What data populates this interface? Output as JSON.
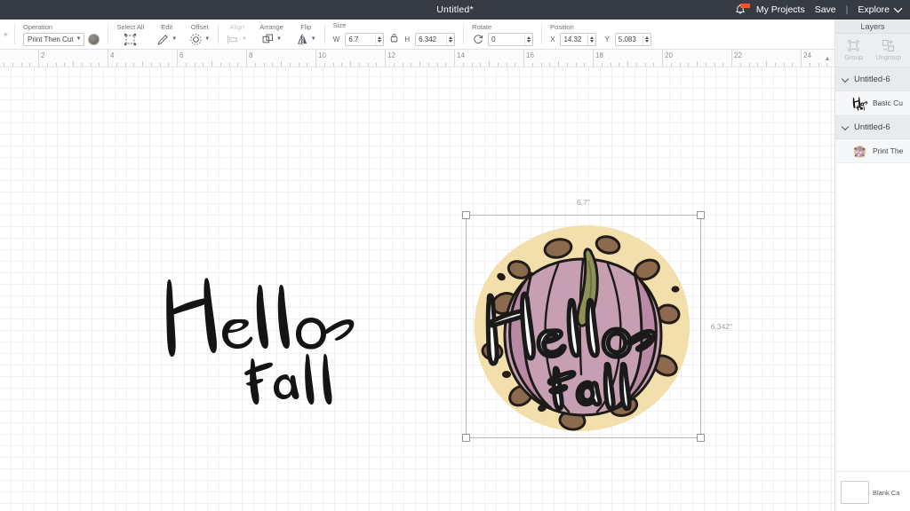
{
  "topbar": {
    "title": "Untitled*",
    "bell_icon": "bell-icon",
    "my_projects": "My Projects",
    "save": "Save",
    "divider": "|",
    "machine": "Explore",
    "machine_caret": "chevron-down-icon"
  },
  "toolbar": {
    "operation": {
      "label": "Operation",
      "value": "Print Then Cut",
      "color_swatch": "color-swatch"
    },
    "select_all": {
      "label": "Select All",
      "icon": "select-all-icon"
    },
    "edit": {
      "label": "Edit",
      "icon": "pencil-icon"
    },
    "offset": {
      "label": "Offset",
      "icon": "offset-icon"
    },
    "align": {
      "label": "Align",
      "icon": "align-icon",
      "disabled": true
    },
    "arrange": {
      "label": "Arrange",
      "icon": "arrange-icon"
    },
    "flip": {
      "label": "Flip",
      "icon": "flip-icon"
    },
    "size": {
      "label": "Size",
      "lock_icon": "lock-icon",
      "w_letter": "W",
      "w_value": "6.7",
      "h_letter": "H",
      "h_value": "6.342"
    },
    "rotate": {
      "label": "Rotate",
      "icon": "rotate-icon",
      "value": "0"
    },
    "position": {
      "label": "Position",
      "x_letter": "X",
      "x_value": "14.32",
      "y_letter": "Y",
      "y_value": "5.083"
    }
  },
  "ruler": {
    "labels": [
      "2",
      "4",
      "6",
      "8",
      "10",
      "12",
      "14",
      "16",
      "18",
      "20",
      "22",
      "24"
    ],
    "scroll_up_icon": "caret-up-icon"
  },
  "canvas": {
    "selection": {
      "width_label": "6.7\"",
      "height_label": "6.342\"",
      "handles": [
        "top-left",
        "top-right",
        "bottom-left",
        "bottom-right"
      ]
    },
    "artwork_black": {
      "line1": "Hello",
      "line2": "Fall"
    },
    "artwork_pumpkin": {
      "line1": "Hello",
      "line2": "Fall"
    }
  },
  "right_panel": {
    "tab": "Layers",
    "group_button": {
      "label": "Group",
      "icon": "group-icon"
    },
    "ungroup_button": {
      "label": "Ungroup",
      "icon": "ungroup-icon"
    },
    "layers": [
      {
        "group_name": "Untitled-6",
        "child_label": "Basic Cu",
        "thumb": "hello-fall-black-thumb"
      },
      {
        "group_name": "Untitled-6",
        "child_label": "Print The",
        "thumb": "pumpkin-thumb"
      }
    ],
    "canvas_chip": {
      "label": "Blank Ca",
      "swatch": "blank-canvas-swatch"
    }
  },
  "colors": {
    "topbar_bg": "#373c44",
    "badge": "#f05a22",
    "pumpkin_body": "#c9a0b4",
    "pumpkin_body_dark": "#b98aa3",
    "pumpkin_stem": "#8d9157",
    "leopard_cream": "#f0dca4",
    "leopard_brown": "#8a6a4f",
    "leopard_dark": "#2e2622",
    "ink": "#1a1a1a"
  }
}
